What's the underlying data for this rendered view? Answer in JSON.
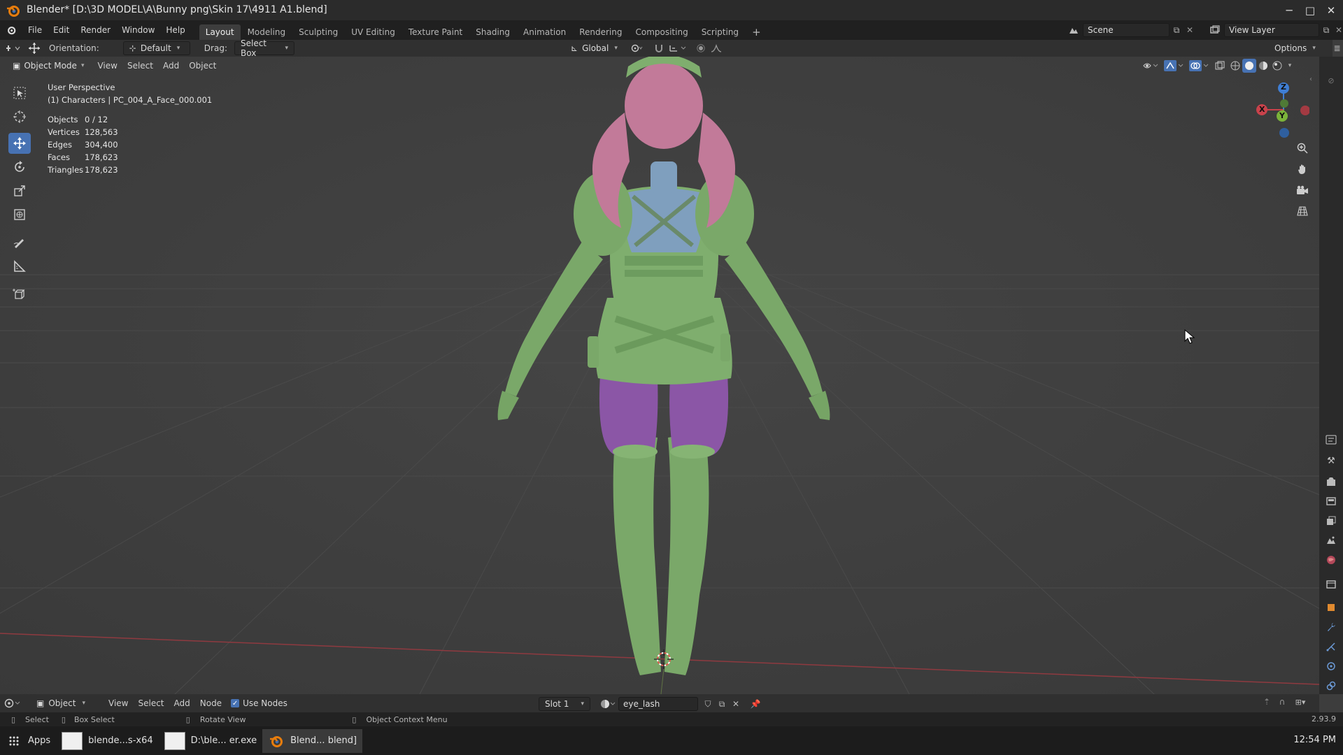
{
  "window": {
    "title": "Blender* [D:\\3D MODEL\\A\\Bunny png\\Skin 17\\4911 A1.blend]",
    "minimize": "─",
    "maximize": "□",
    "close": "✕"
  },
  "menubar": {
    "items": [
      "File",
      "Edit",
      "Render",
      "Window",
      "Help"
    ]
  },
  "workspaces": [
    "Layout",
    "Modeling",
    "Sculpting",
    "UV Editing",
    "Texture Paint",
    "Shading",
    "Animation",
    "Rendering",
    "Compositing",
    "Scripting"
  ],
  "active_workspace": "Layout",
  "scene": {
    "label": "Scene"
  },
  "view_layer": {
    "label": "View Layer"
  },
  "tool_header": {
    "orientation_label": "Orientation:",
    "orientation_value": "Default",
    "drag_label": "Drag:",
    "drag_value": "Select Box",
    "transform_space": "Global",
    "options": "Options"
  },
  "viewport_header": {
    "mode": "Object Mode",
    "menus": [
      "View",
      "Select",
      "Add",
      "Object"
    ]
  },
  "overlay": {
    "perspective": "User Perspective",
    "collection_object": "(1) Characters | PC_004_A_Face_000.001",
    "stats": [
      {
        "key": "Objects",
        "value": "0 / 12"
      },
      {
        "key": "Vertices",
        "value": "128,563"
      },
      {
        "key": "Edges",
        "value": "304,400"
      },
      {
        "key": "Faces",
        "value": "178,623"
      },
      {
        "key": "Triangles",
        "value": "178,623"
      }
    ]
  },
  "gizmo": {
    "x": "X",
    "y": "Y",
    "z": "Z"
  },
  "shader_header": {
    "object_type": "Object",
    "menus": [
      "View",
      "Select",
      "Add",
      "Node"
    ],
    "use_nodes": "Use Nodes",
    "slot": "Slot 1",
    "material": "eye_lash"
  },
  "statusbar": {
    "select": "Select",
    "box_select": "Box Select",
    "rotate_view": "Rotate View",
    "context_menu": "Object Context Menu",
    "version": "2.93.9"
  },
  "taskbar": {
    "apps": "Apps",
    "tasks": [
      "blende...s-x64",
      "D:\\ble... er.exe",
      "Blend... blend]"
    ],
    "clock": "12:54 PM"
  },
  "colors": {
    "accent": "#4772b3",
    "model_body": "#7fae6e",
    "hair": "#c27a99",
    "stockings": "#8b56a6",
    "vest": "#7f9fbe",
    "axis_x": "#c9424b",
    "axis_y": "#7bb33a",
    "axis_z": "#3f7ed4"
  }
}
